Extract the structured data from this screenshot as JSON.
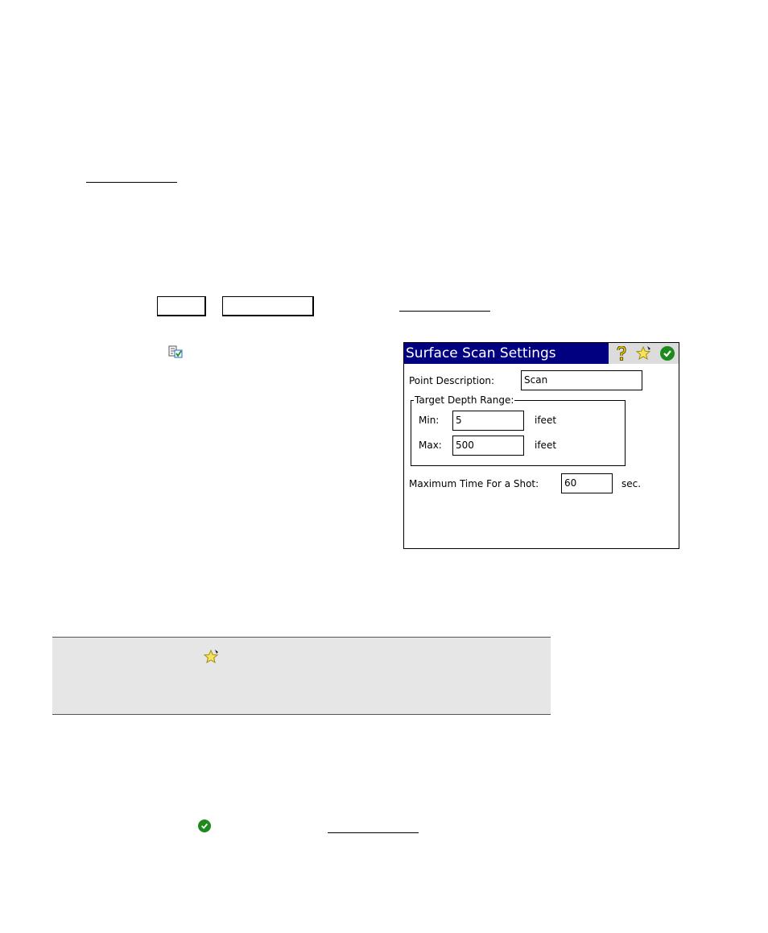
{
  "dialog": {
    "title": "Surface Scan Settings",
    "point_description": {
      "label": "Point Description:",
      "value": "Scan"
    },
    "target_depth_range": {
      "legend": "Target Depth Range:",
      "min": {
        "label": "Min:",
        "value": "5",
        "unit": "ifeet"
      },
      "max": {
        "label": "Max:",
        "value": "500",
        "unit": "ifeet"
      }
    },
    "max_time": {
      "label": "Maximum Time For a Shot:",
      "value": "60",
      "unit": "sec."
    }
  },
  "icons": {
    "help": "question-icon",
    "favorite": "star-icon",
    "ok": "check-icon",
    "settings": "checklist-icon"
  },
  "colors": {
    "title_bar": "#000080",
    "toolbar_bg": "#dcdcdc",
    "ok_green": "#1e8a1e",
    "note_bg": "#e6e6e6"
  }
}
